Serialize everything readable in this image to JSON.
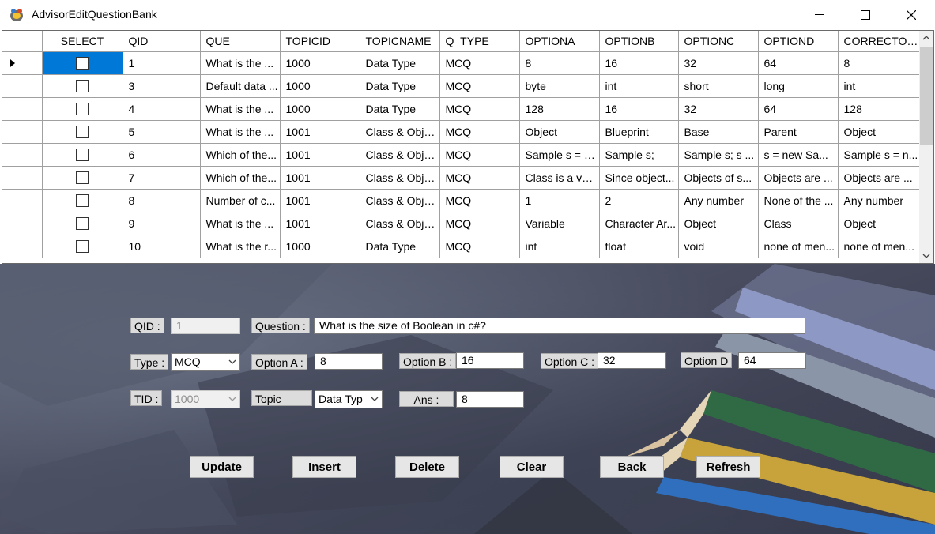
{
  "window": {
    "title": "AdvisorEditQuestionBank"
  },
  "grid": {
    "columns": [
      "SELECT",
      "QID",
      "QUE",
      "TOPICID",
      "TOPICNAME",
      "Q_TYPE",
      "OPTIONA",
      "OPTIONB",
      "OPTIONC",
      "OPTIOND",
      "CORRECTOPT"
    ],
    "rows": [
      {
        "qid": "1",
        "que": "What is the ...",
        "topicid": "1000",
        "topicname": "Data Type",
        "qtype": "MCQ",
        "a": "8",
        "b": "16",
        "c": "32",
        "d": "64",
        "correct": "8"
      },
      {
        "qid": "3",
        "que": "Default data ...",
        "topicid": "1000",
        "topicname": "Data Type",
        "qtype": "MCQ",
        "a": "byte",
        "b": "int",
        "c": "short",
        "d": "long",
        "correct": "int"
      },
      {
        "qid": "4",
        "que": " What is the ...",
        "topicid": "1000",
        "topicname": "Data Type",
        "qtype": "MCQ",
        "a": "128",
        "b": " 16",
        "c": " 32",
        "d": " 64",
        "correct": "128"
      },
      {
        "qid": "5",
        "que": "What is the ...",
        "topicid": "1001",
        "topicname": "Class & Obje...",
        "qtype": "MCQ",
        "a": "Object",
        "b": "Blueprint",
        "c": "Base",
        "d": "Parent",
        "correct": "Object"
      },
      {
        "qid": "6",
        "que": "Which of the...",
        "topicid": "1001",
        "topicname": "Class & Obje...",
        "qtype": "MCQ",
        "a": "Sample s = n...",
        "b": "Sample s;",
        "c": "Sample s; s ...",
        "d": "s = new Sa...",
        "correct": "Sample s = n..."
      },
      {
        "qid": "7",
        "que": "Which of the...",
        "topicid": "1001",
        "topicname": "Class & Obje...",
        "qtype": "MCQ",
        "a": "Class is a val...",
        "b": "Since object...",
        "c": "Objects of s...",
        "d": "Objects are ...",
        "correct": "Objects are ..."
      },
      {
        "qid": "8",
        "que": "Number of c...",
        "topicid": "1001",
        "topicname": "Class & Obje...",
        "qtype": "MCQ",
        "a": "1",
        "b": "2",
        "c": "Any number",
        "d": "None of the ...",
        "correct": "Any number"
      },
      {
        "qid": "9",
        "que": "What is the ...",
        "topicid": "1001",
        "topicname": "Class & Obje...",
        "qtype": "MCQ",
        "a": "Variable",
        "b": "Character Ar...",
        "c": "Object",
        "d": "Class",
        "correct": "Object"
      },
      {
        "qid": "10",
        "que": "What is the r...",
        "topicid": "1000",
        "topicname": "Data Type",
        "qtype": "MCQ",
        "a": "int",
        "b": "float",
        "c": "void",
        "d": "none of men...",
        "correct": "none of men..."
      }
    ]
  },
  "form": {
    "qid_label": "QID :",
    "qid_value": "1",
    "question_label": "Question :",
    "question_value": "What is the size of Boolean in c#?",
    "type_label": "Type :",
    "type_value": "MCQ",
    "option_a_label": "Option A :",
    "option_a_value": "8",
    "option_b_label": "Option B :",
    "option_b_value": "16",
    "option_c_label": "Option C :",
    "option_c_value": "32",
    "option_d_label": "Option D",
    "option_d_value": "64",
    "tid_label": "TID :",
    "tid_value": "1000",
    "topic_label": "Topic",
    "topic_value": "Data Typ",
    "ans_label": "Ans :",
    "ans_value": "8"
  },
  "buttons": {
    "update": "Update",
    "insert": "Insert",
    "delete": "Delete",
    "clear": "Clear",
    "back": "Back",
    "refresh": "Refresh"
  },
  "colors": {
    "selection": "#0078d7",
    "button_face": "#e6e6e6",
    "label_face": "#dcdcdc"
  }
}
